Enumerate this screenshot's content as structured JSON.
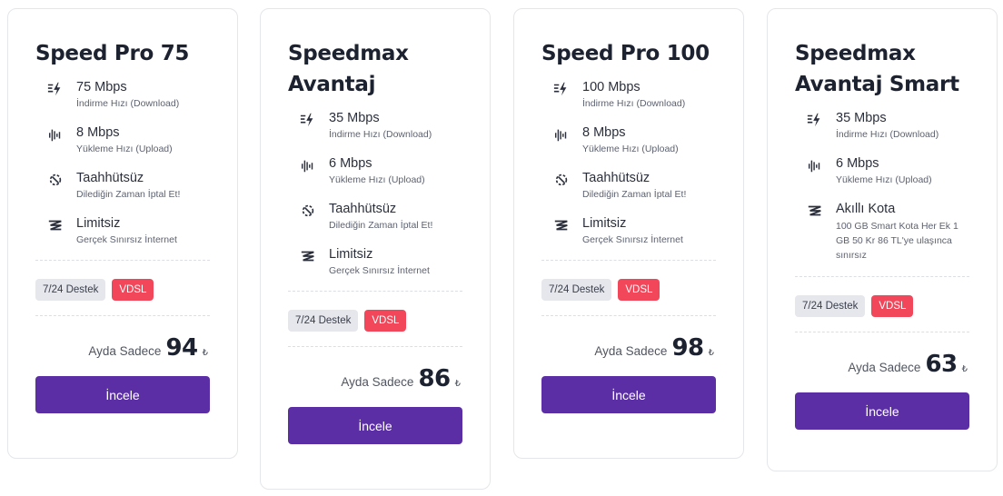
{
  "plans": [
    {
      "title": "Speed Pro 75",
      "features": [
        {
          "icon": "download-speed-icon",
          "value": "75 Mbps",
          "desc": "İndirme Hızı (Download)"
        },
        {
          "icon": "upload-speed-icon",
          "value": "8 Mbps",
          "desc": "Yükleme Hızı (Upload)"
        },
        {
          "icon": "no-commitment-icon",
          "value": "Taahhütsüz",
          "desc": "Dilediğin Zaman İptal Et!"
        },
        {
          "icon": "unlimited-icon",
          "value": "Limitsiz",
          "desc": "Gerçek Sınırsız İnternet"
        }
      ],
      "badges": {
        "support": "7/24 Destek",
        "tech": "VDSL"
      },
      "price": {
        "prefix": "Ayda Sadece",
        "value": "94",
        "currency": "₺"
      },
      "cta": "İncele"
    },
    {
      "title": "Speedmax Avantaj",
      "features": [
        {
          "icon": "download-speed-icon",
          "value": "35 Mbps",
          "desc": "İndirme Hızı (Download)"
        },
        {
          "icon": "upload-speed-icon",
          "value": "6 Mbps",
          "desc": "Yükleme Hızı (Upload)"
        },
        {
          "icon": "no-commitment-icon",
          "value": "Taahhütsüz",
          "desc": "Dilediğin Zaman İptal Et!"
        },
        {
          "icon": "unlimited-icon",
          "value": "Limitsiz",
          "desc": "Gerçek Sınırsız İnternet"
        }
      ],
      "badges": {
        "support": "7/24 Destek",
        "tech": "VDSL"
      },
      "price": {
        "prefix": "Ayda Sadece",
        "value": "86",
        "currency": "₺"
      },
      "cta": "İncele"
    },
    {
      "title": "Speed Pro 100",
      "features": [
        {
          "icon": "download-speed-icon",
          "value": "100 Mbps",
          "desc": "İndirme Hızı (Download)"
        },
        {
          "icon": "upload-speed-icon",
          "value": "8 Mbps",
          "desc": "Yükleme Hızı (Upload)"
        },
        {
          "icon": "no-commitment-icon",
          "value": "Taahhütsüz",
          "desc": "Dilediğin Zaman İptal Et!"
        },
        {
          "icon": "unlimited-icon",
          "value": "Limitsiz",
          "desc": "Gerçek Sınırsız İnternet"
        }
      ],
      "badges": {
        "support": "7/24 Destek",
        "tech": "VDSL"
      },
      "price": {
        "prefix": "Ayda Sadece",
        "value": "98",
        "currency": "₺"
      },
      "cta": "İncele"
    },
    {
      "title": "Speedmax Avantaj Smart",
      "features": [
        {
          "icon": "download-speed-icon",
          "value": "35 Mbps",
          "desc": "İndirme Hızı (Download)"
        },
        {
          "icon": "upload-speed-icon",
          "value": "6 Mbps",
          "desc": "Yükleme Hızı (Upload)"
        },
        {
          "icon": "quota-icon",
          "value": "Akıllı Kota",
          "desc": "100 GB Smart Kota Her Ek 1 GB 50 Kr 86 TL'ye ulaşınca sınırsız"
        }
      ],
      "badges": {
        "support": "7/24 Destek",
        "tech": "VDSL"
      },
      "price": {
        "prefix": "Ayda Sadece",
        "value": "63",
        "currency": "₺"
      },
      "cta": "İncele"
    }
  ],
  "colors": {
    "accent": "#5b2ea6",
    "vdsl": "#f2475a",
    "support_bg": "#e6e7ec"
  }
}
